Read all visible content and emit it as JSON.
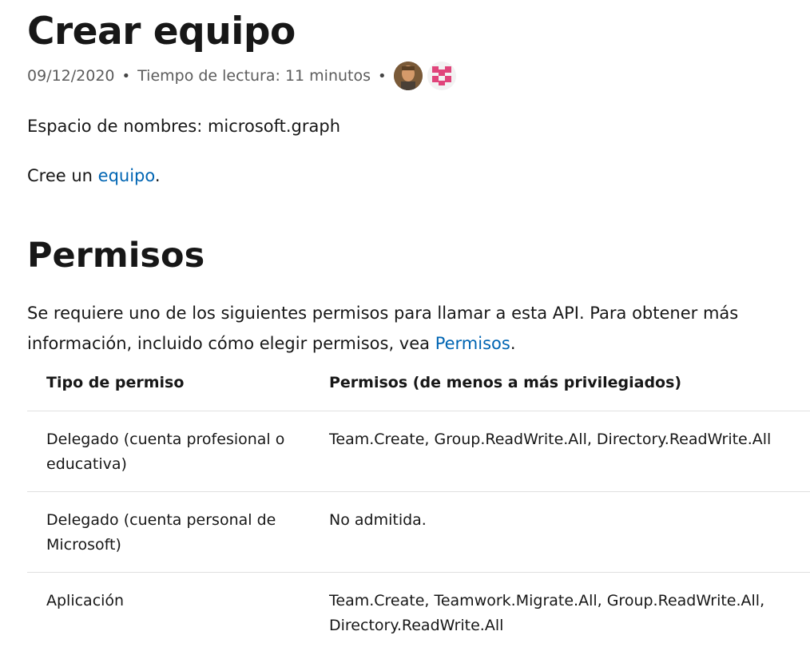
{
  "article": {
    "title": "Crear equipo",
    "date": "09/12/2020",
    "separator": "•",
    "reading_time": "Tiempo de lectura: 11 minutos",
    "namespace": "Espacio de nombres: microsoft.graph",
    "intro_prefix": "Cree un ",
    "intro_link": "equipo",
    "intro_suffix": "."
  },
  "permissions": {
    "heading": "Permisos",
    "text_line1": "Se requiere uno de los siguientes permisos para llamar a esta API. Para obtener más",
    "text_line2_prefix": "información, incluido cómo elegir permisos, vea ",
    "text_link": "Permisos",
    "text_suffix": ".",
    "columns": [
      "Tipo de permiso",
      "Permisos (de menos a más privilegiados)"
    ],
    "rows": [
      {
        "type": "Delegado (cuenta profesional o educativa)",
        "perms": "Team.Create, Group.ReadWrite.All, Directory.ReadWrite.All"
      },
      {
        "type": "Delegado (cuenta personal de Microsoft)",
        "perms": "No admitida."
      },
      {
        "type": "Aplicación",
        "perms": "Team.Create, Teamwork.Migrate.All, Group.ReadWrite.All, Directory.ReadWrite.All"
      }
    ]
  },
  "contributors": [
    {
      "icon": "contributor-photo-avatar"
    },
    {
      "icon": "contributor-identicon-avatar"
    }
  ],
  "colors": {
    "link": "#0065b3",
    "text": "#171717",
    "meta": "#5c5c5c",
    "border": "#e0e0e0"
  }
}
